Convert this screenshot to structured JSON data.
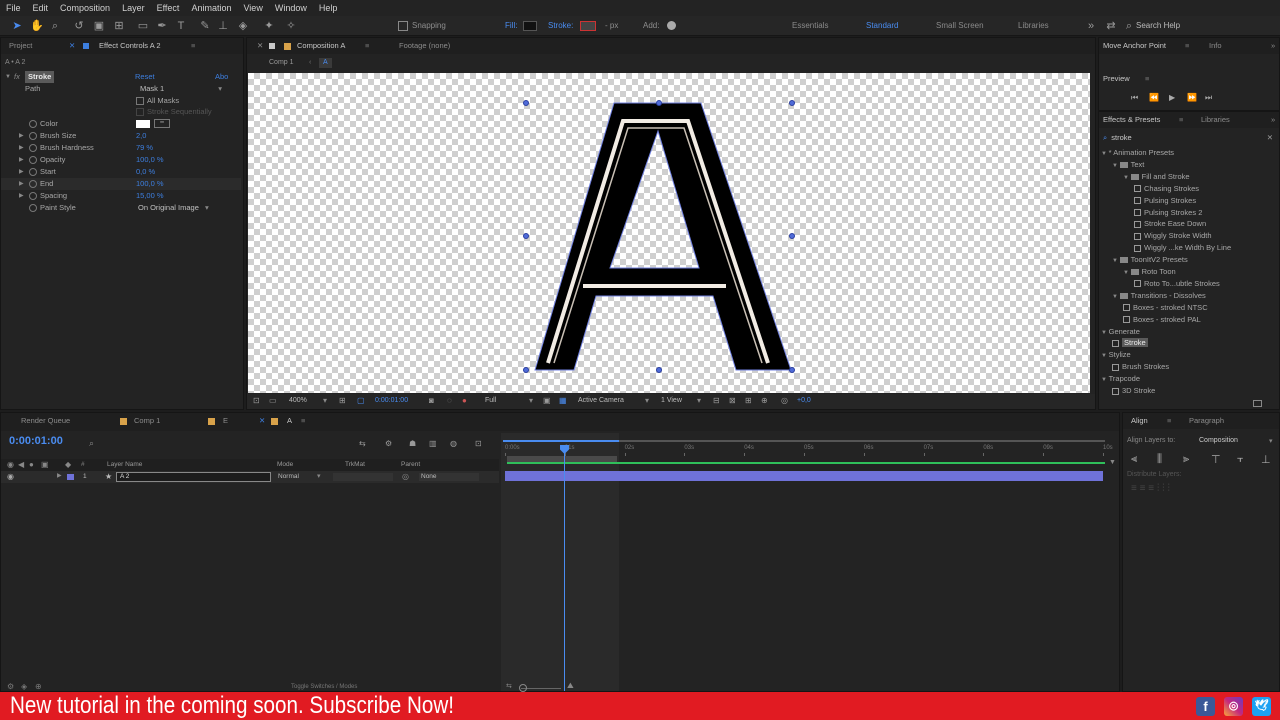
{
  "menu": [
    "File",
    "Edit",
    "Composition",
    "Layer",
    "Effect",
    "Animation",
    "View",
    "Window",
    "Help"
  ],
  "toolbar": {
    "snapping": "Snapping",
    "fill": "Fill:",
    "stroke": "Stroke:",
    "stroke_unit": "- px",
    "add": "Add:",
    "workspaces": [
      "Essentials",
      "Standard",
      "Small Screen",
      "Libraries"
    ],
    "active_workspace": "Standard",
    "search_help": "Search Help"
  },
  "project_panel": {
    "tab_project": "Project",
    "tab_effect_controls": "Effect Controls A 2",
    "layer_path": "A • A 2",
    "effect": {
      "name": "Stroke",
      "reset": "Reset",
      "about": "Abo",
      "path_label": "Path",
      "path_value": "Mask 1",
      "all_masks": "All Masks",
      "stroke_seq": "Stroke Sequentially",
      "props": [
        {
          "label": "Color",
          "value": ""
        },
        {
          "label": "Brush Size",
          "value": "2,0"
        },
        {
          "label": "Brush Hardness",
          "value": "79 %"
        },
        {
          "label": "Opacity",
          "value": "100,0 %"
        },
        {
          "label": "Start",
          "value": "0,0 %"
        },
        {
          "label": "End",
          "value": "100,0 %"
        },
        {
          "label": "Spacing",
          "value": "15,00 %"
        },
        {
          "label": "Paint Style",
          "value": "On Original Image"
        }
      ]
    }
  },
  "composition": {
    "tab": "Composition A",
    "footage_tab": "Footage (none)",
    "breadcrumb_1": "Comp 1",
    "breadcrumb_2": "A",
    "glyph": "A",
    "zoom": "400%",
    "timecode": "0:00:01:00",
    "resolution": "Full",
    "camera": "Active Camera",
    "view": "1 View",
    "exposure": "+0,0"
  },
  "right_top": {
    "tab_anchor": "Move Anchor Point",
    "tab_info": "Info",
    "preview_title": "Preview"
  },
  "effects_presets": {
    "tab": "Effects & Presets",
    "tab_libraries": "Libraries",
    "search": "stroke",
    "tree": [
      {
        "level": 0,
        "type": "cat",
        "label": "* Animation Presets"
      },
      {
        "level": 1,
        "type": "folder",
        "label": "Text"
      },
      {
        "level": 2,
        "type": "folder",
        "label": "Fill and Stroke"
      },
      {
        "level": 3,
        "type": "preset",
        "label": "Chasing Strokes"
      },
      {
        "level": 3,
        "type": "preset",
        "label": "Pulsing Strokes"
      },
      {
        "level": 3,
        "type": "preset",
        "label": "Pulsing Strokes 2"
      },
      {
        "level": 3,
        "type": "preset",
        "label": "Stroke Ease Down"
      },
      {
        "level": 3,
        "type": "preset",
        "label": "Wiggly Stroke Width"
      },
      {
        "level": 3,
        "type": "preset",
        "label": "Wiggly ...ke Width By Line"
      },
      {
        "level": 1,
        "type": "folder",
        "label": "ToonItV2 Presets"
      },
      {
        "level": 2,
        "type": "folder",
        "label": "Roto Toon"
      },
      {
        "level": 3,
        "type": "preset",
        "label": "Roto To...ubtle Strokes"
      },
      {
        "level": 1,
        "type": "folder",
        "label": "Transitions - Dissolves"
      },
      {
        "level": 2,
        "type": "preset",
        "label": "Boxes - stroked NTSC"
      },
      {
        "level": 2,
        "type": "preset",
        "label": "Boxes - stroked PAL"
      },
      {
        "level": 0,
        "type": "cat",
        "label": "Generate"
      },
      {
        "level": 1,
        "type": "preset",
        "label": "Stroke",
        "selected": true
      },
      {
        "level": 0,
        "type": "cat",
        "label": "Stylize"
      },
      {
        "level": 1,
        "type": "preset",
        "label": "Brush Strokes"
      },
      {
        "level": 0,
        "type": "cat",
        "label": "Trapcode"
      },
      {
        "level": 1,
        "type": "preset",
        "label": "3D Stroke"
      }
    ]
  },
  "timeline": {
    "tab_render": "Render Queue",
    "tab_comp1": "Comp 1",
    "tab_e": "E",
    "tab_a": "A",
    "timecode": "0:00:01:00",
    "col_layer_name": "Layer Name",
    "col_mode": "Mode",
    "col_trkmat": "TrkMat",
    "col_parent": "Parent",
    "layer_num": "1",
    "layer_name": "A 2",
    "layer_mode": "Normal",
    "layer_parent": "None",
    "ticks": [
      "0:00s",
      "01s",
      "02s",
      "03s",
      "04s",
      "05s",
      "06s",
      "07s",
      "08s",
      "09s",
      "10s"
    ],
    "toggle": "Toggle Switches / Modes"
  },
  "align": {
    "tab": "Align",
    "tab_paragraph": "Paragraph",
    "align_to_label": "Align Layers to:",
    "align_to_value": "Composition",
    "distribute": "Distribute Layers:"
  },
  "banner": {
    "text": "New tutorial in the coming soon. Subscribe Now!",
    "color": "#e11b22"
  },
  "social": [
    "facebook-icon",
    "instagram-icon",
    "twitter-icon"
  ]
}
